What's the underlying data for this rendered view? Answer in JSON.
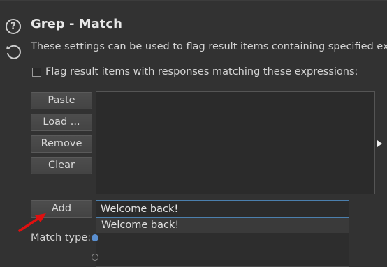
{
  "panel": {
    "title": "Grep - Match",
    "description": "These settings can be used to flag result items containing specified expre",
    "flag_label": "Flag result items with responses matching these expressions:"
  },
  "buttons": {
    "paste": "Paste",
    "load": "Load ...",
    "remove": "Remove",
    "clear": "Clear",
    "add": "Add"
  },
  "add_input": {
    "value": "Welcome back!"
  },
  "autocomplete": {
    "items": [
      "Welcome back!"
    ]
  },
  "match_type": {
    "label": "Match type:"
  },
  "icons": {
    "help": "help-icon",
    "reset": "reset-icon",
    "annotation": "red-arrow-icon"
  },
  "colors": {
    "background": "#323232",
    "focus_border": "#4b7fad",
    "annotation_arrow": "#e01010"
  }
}
